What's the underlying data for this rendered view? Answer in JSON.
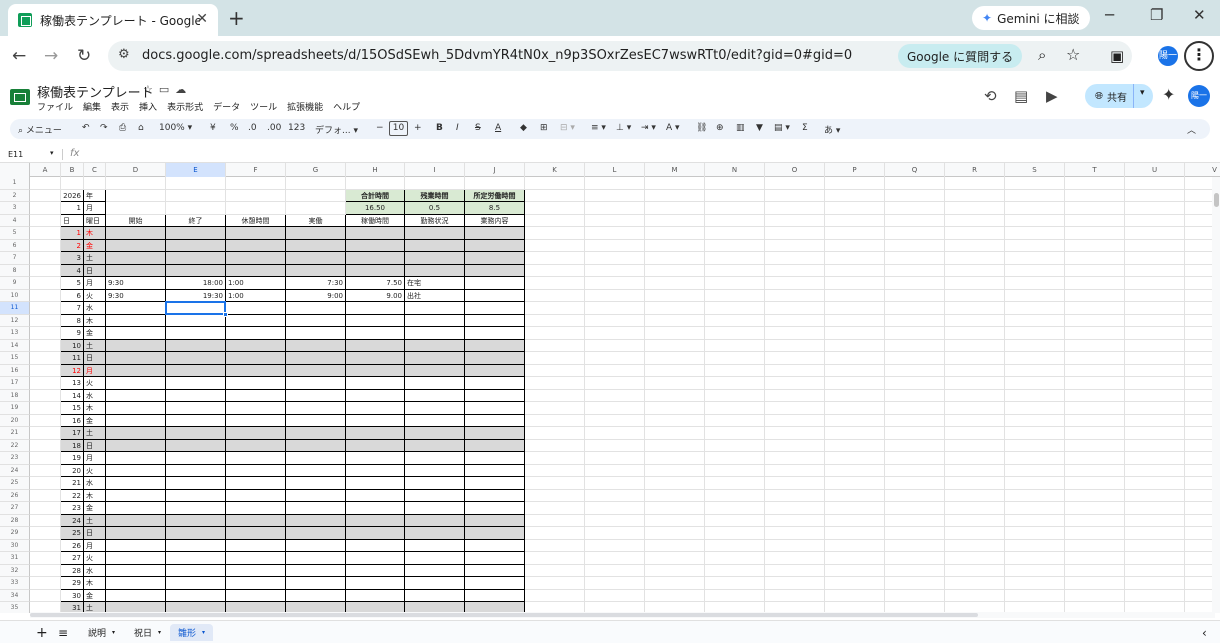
{
  "browser": {
    "tab_title": "稼働表テンプレート - Google スプレ",
    "close": "✕",
    "new_tab": "+",
    "gemini_label": "Gemini に相談",
    "url": "docs.google.com/spreadsheets/d/15OSdSEwh_5DdvmYR4tN0x_n9p3SOxrZesEC7wswRTt0/edit?gid=0#gid=0",
    "ask_google": "Google に質問する",
    "profile_initial": "陽一"
  },
  "sheets": {
    "doc_title": "稼働表テンプレート",
    "menu": [
      "ファイル",
      "編集",
      "表示",
      "挿入",
      "表示形式",
      "データ",
      "ツール",
      "拡張機能",
      "ヘルプ"
    ],
    "share_label": "共有",
    "toolbar": {
      "menu_search": "メニュー",
      "zoom": "100%",
      "currency": "¥",
      "percent": "%",
      "dec_less": ".0",
      "dec_more": ".00",
      "format_123": "123",
      "font": "デフォ...",
      "font_size": "10"
    },
    "name_box": "E11",
    "fx": "fx",
    "sheet_tabs": [
      "説明",
      "祝日",
      "雛形"
    ],
    "active_tab": "雛形"
  },
  "grid": {
    "columns": [
      "A",
      "B",
      "C",
      "D",
      "E",
      "F",
      "G",
      "H",
      "I",
      "J",
      "K",
      "L",
      "M",
      "N",
      "O",
      "P",
      "Q",
      "R",
      "S",
      "T",
      "U",
      "V"
    ],
    "selected_column": "E",
    "selected_row": 11,
    "rows": [
      {
        "n": 1
      },
      {
        "n": 2,
        "B": "2026",
        "C": "年",
        "H": "合計時間",
        "I": "残業時間",
        "J": "所定労働時間"
      },
      {
        "n": 3,
        "B": "1",
        "C": "月",
        "H": "16.50",
        "I": "0.5",
        "J": "8.5"
      },
      {
        "n": 4,
        "B": "日",
        "C": "曜日",
        "D": "開始",
        "E": "終了",
        "F": "休憩時間",
        "G": "実働",
        "H": "稼働時間",
        "I": "勤務状況",
        "J": "業務内容"
      },
      {
        "n": 5,
        "B": "1",
        "C": "木",
        "red": true,
        "gray": true
      },
      {
        "n": 6,
        "B": "2",
        "C": "金",
        "red": true,
        "gray": true
      },
      {
        "n": 7,
        "B": "3",
        "C": "土",
        "gray": true
      },
      {
        "n": 8,
        "B": "4",
        "C": "日",
        "gray": true
      },
      {
        "n": 9,
        "B": "5",
        "C": "月",
        "D": "9:30",
        "E": "18:00",
        "F": "1:00",
        "G": "7:30",
        "H": "7.50",
        "I": "在宅"
      },
      {
        "n": 10,
        "B": "6",
        "C": "火",
        "D": "9:30",
        "E": "19:30",
        "F": "1:00",
        "G": "9:00",
        "H": "9.00",
        "I": "出社"
      },
      {
        "n": 11,
        "B": "7",
        "C": "水"
      },
      {
        "n": 12,
        "B": "8",
        "C": "木"
      },
      {
        "n": 13,
        "B": "9",
        "C": "金"
      },
      {
        "n": 14,
        "B": "10",
        "C": "土",
        "gray": true
      },
      {
        "n": 15,
        "B": "11",
        "C": "日",
        "gray": true
      },
      {
        "n": 16,
        "B": "12",
        "C": "月",
        "red": true,
        "gray": true
      },
      {
        "n": 17,
        "B": "13",
        "C": "火"
      },
      {
        "n": 18,
        "B": "14",
        "C": "水"
      },
      {
        "n": 19,
        "B": "15",
        "C": "木"
      },
      {
        "n": 20,
        "B": "16",
        "C": "金"
      },
      {
        "n": 21,
        "B": "17",
        "C": "土",
        "gray": true
      },
      {
        "n": 22,
        "B": "18",
        "C": "日",
        "gray": true
      },
      {
        "n": 23,
        "B": "19",
        "C": "月"
      },
      {
        "n": 24,
        "B": "20",
        "C": "火"
      },
      {
        "n": 25,
        "B": "21",
        "C": "水"
      },
      {
        "n": 26,
        "B": "22",
        "C": "木"
      },
      {
        "n": 27,
        "B": "23",
        "C": "金"
      },
      {
        "n": 28,
        "B": "24",
        "C": "土",
        "gray": true
      },
      {
        "n": 29,
        "B": "25",
        "C": "日",
        "gray": true
      },
      {
        "n": 30,
        "B": "26",
        "C": "月"
      },
      {
        "n": 31,
        "B": "27",
        "C": "火"
      },
      {
        "n": 32,
        "B": "28",
        "C": "水"
      },
      {
        "n": 33,
        "B": "29",
        "C": "木"
      },
      {
        "n": 34,
        "B": "30",
        "C": "金"
      },
      {
        "n": 35,
        "B": "31",
        "C": "土",
        "gray": true
      }
    ]
  }
}
